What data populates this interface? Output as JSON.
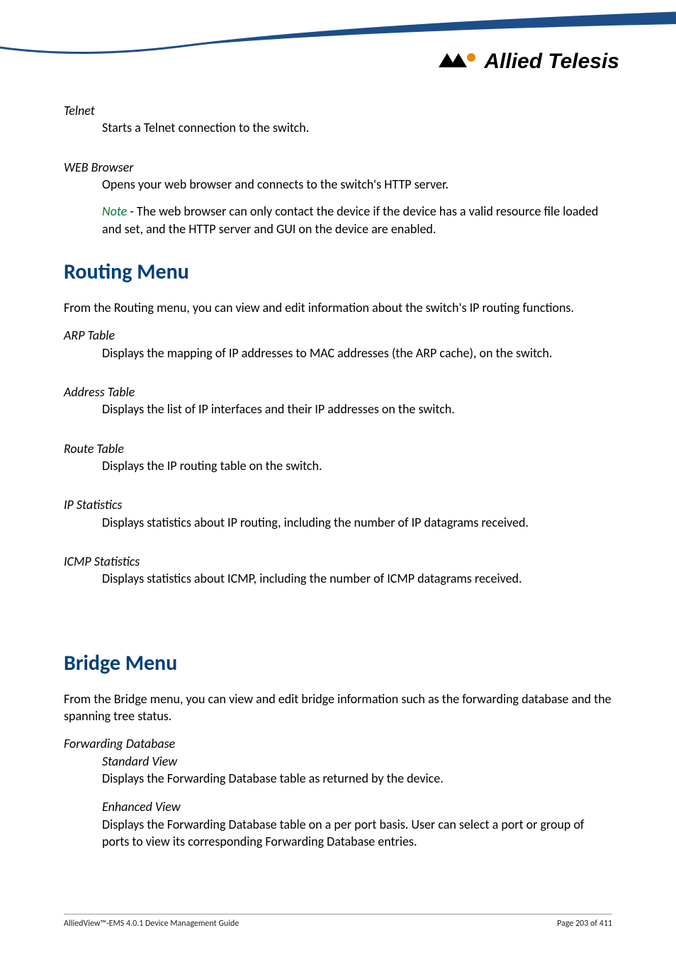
{
  "brand": {
    "name": "Allied Telesis"
  },
  "telnet": {
    "heading": "Telnet",
    "body": "Starts a Telnet connection to the switch."
  },
  "web": {
    "heading": "WEB Browser",
    "body": "Opens your web browser and connects to the switch's HTTP server.",
    "note_label": "Note",
    "note_body": " - The web browser can only contact the device if the device has a valid resource file loaded and set, and the HTTP server and GUI on the device are enabled."
  },
  "routing": {
    "title": "Routing Menu",
    "intro": "From the Routing menu, you can view and edit information about the switch's IP routing functions.",
    "items": [
      {
        "heading": "ARP Table",
        "body": "Displays the mapping of IP addresses to MAC addresses (the ARP cache), on the switch."
      },
      {
        "heading": "Address Table",
        "body": "Displays the list of IP interfaces and their IP addresses on the switch."
      },
      {
        "heading": "Route Table",
        "body": "Displays the IP routing table on the switch."
      },
      {
        "heading": "IP Statistics",
        "body": "Displays statistics about IP routing, including the number of IP datagrams received."
      },
      {
        "heading": "ICMP Statistics",
        "body": "Displays statistics about ICMP, including the number of ICMP datagrams received."
      }
    ]
  },
  "bridge": {
    "title": "Bridge Menu",
    "intro": "From the Bridge menu, you can view and edit bridge information such as the forwarding database and the spanning tree status.",
    "fdb": {
      "heading": "Forwarding Database",
      "std_label": "Standard View",
      "std_body": "Displays the Forwarding Database table as returned by the device.",
      "enh_label": "Enhanced View",
      "enh_body": "Displays the Forwarding Database table on a per port basis. User can select a port or group of ports to view its corresponding Forwarding Database entries."
    }
  },
  "footer": {
    "left": "AlliedView™-EMS 4.0.1 Device Management Guide",
    "right": "Page 203 of 411"
  }
}
